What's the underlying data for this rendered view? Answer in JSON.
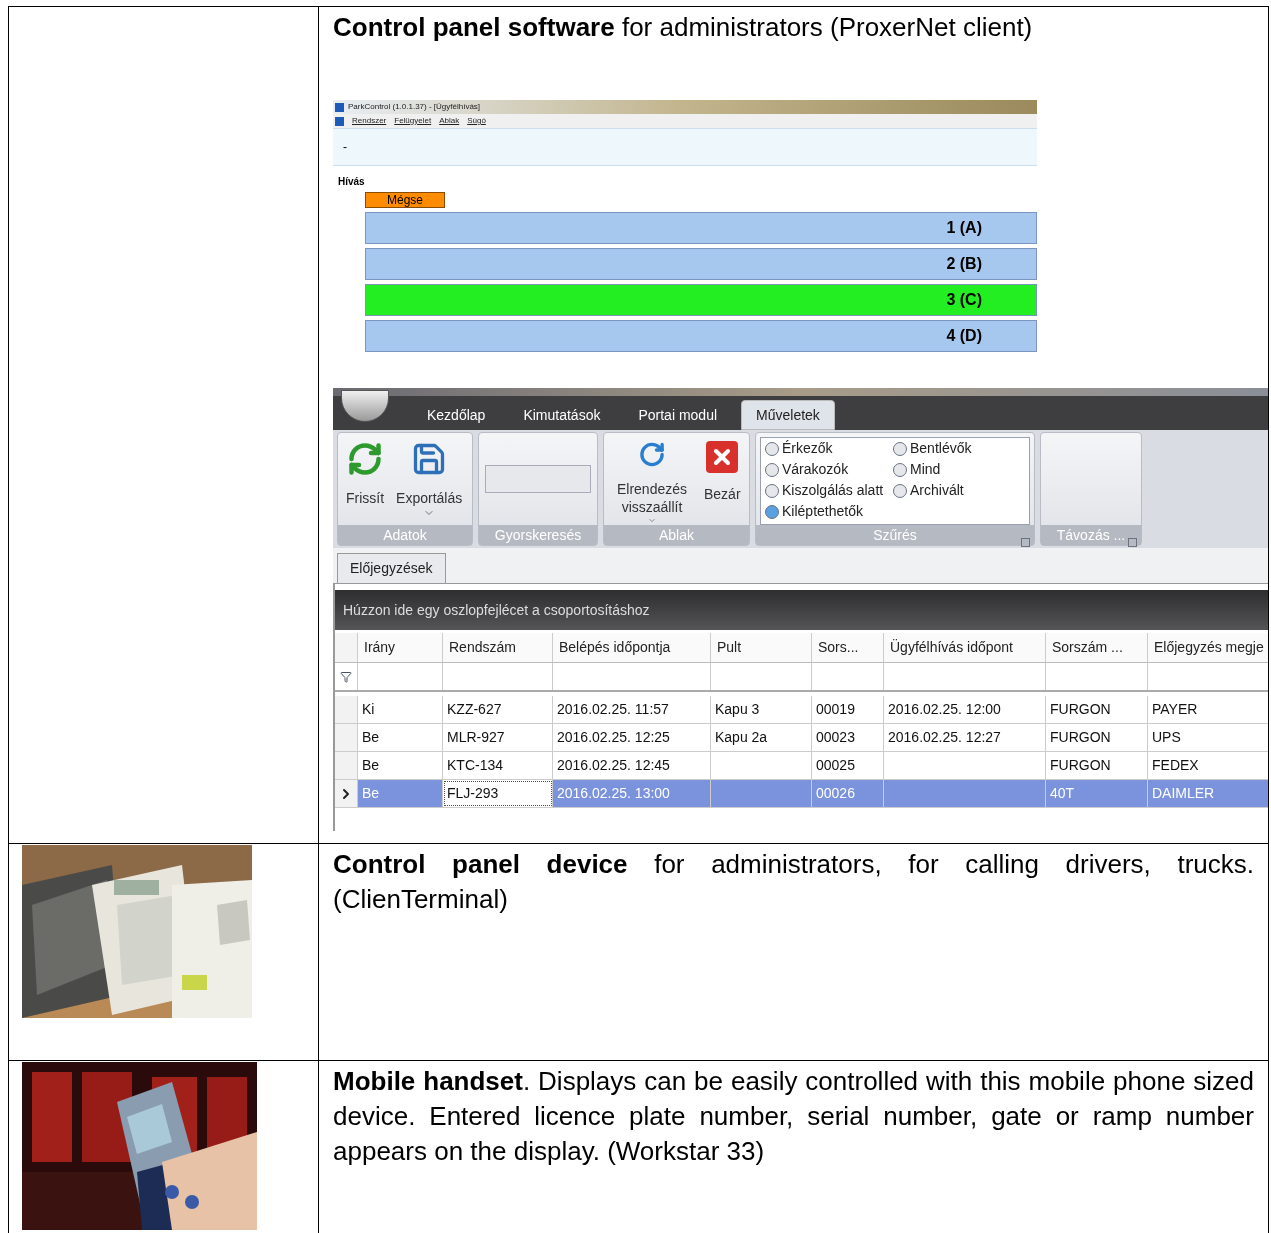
{
  "rows": [
    {
      "left": {
        "kind": "empty"
      },
      "description": "**Control panel software** for administrators (ProxerNet client)",
      "call_window": {
        "title": "ParkControl (1.0.1.37) - [Ügyfélhívás]",
        "menu": [
          "Rendszer",
          "Felügyelet",
          "Ablak",
          "Súgó"
        ],
        "status": "-",
        "group_label": "Hívás",
        "cancel_button": "Mégse",
        "calls": [
          {
            "label": "1 (A)",
            "selected": false
          },
          {
            "label": "2 (B)",
            "selected": false
          },
          {
            "label": "3 (C)",
            "selected": true
          },
          {
            "label": "4 (D)",
            "selected": false
          }
        ]
      },
      "admin_window": {
        "tabs": [
          {
            "label": "Kezdőlap",
            "selected": false
          },
          {
            "label": "Kimutatások",
            "selected": false
          },
          {
            "label": "Portai modul",
            "selected": false
          },
          {
            "label": "Műveletek",
            "selected": true
          }
        ],
        "groups": [
          {
            "kind": "buttons",
            "label": "Adatok",
            "buttons": [
              {
                "label": "Frissít",
                "dropdown": false
              },
              {
                "label": "Exportálás",
                "dropdown": true
              }
            ]
          },
          {
            "kind": "search",
            "label": "Gyorskeresés"
          },
          {
            "kind": "buttons",
            "label": "Ablak",
            "buttons": [
              {
                "label": "Elrendezés visszaállít",
                "dropdown": true
              },
              {
                "label": "Bezár",
                "dropdown": false
              }
            ]
          },
          {
            "kind": "filters",
            "label": "Szűrés",
            "options": [
              {
                "label": "Érkezők",
                "selected": false
              },
              {
                "label": "Bentlévők",
                "selected": false
              },
              {
                "label": "Várakozók",
                "selected": false
              },
              {
                "label": "Mind",
                "selected": false
              },
              {
                "label": "Kiszolgálás alatt",
                "selected": false
              },
              {
                "label": "Archivált",
                "selected": false
              },
              {
                "label": "Kiléptethetők",
                "selected": true
              }
            ]
          },
          {
            "kind": "empty",
            "label": "Távozás ..."
          }
        ],
        "document_tab": "Előjegyzések",
        "group_hint": "Húzzon ide egy oszlopfejlécet a csoportosításhoz",
        "columns": [
          "Irány",
          "Rendszám",
          "Belépés időpontja",
          "Pult",
          "Sors...",
          "Ügyfélhívás időpont",
          "Sorszám ...",
          "Előjegyzés megje"
        ],
        "table_rows": [
          {
            "selected": false,
            "cells": [
              {
                "text": "Ki",
                "focused": false
              },
              {
                "text": "KZZ-627",
                "focused": false
              },
              {
                "text": "2016.02.25. 11:57",
                "focused": false
              },
              {
                "text": "Kapu 3",
                "focused": false
              },
              {
                "text": "00019",
                "focused": false
              },
              {
                "text": "2016.02.25. 12:00",
                "focused": false
              },
              {
                "text": "FURGON",
                "focused": false
              },
              {
                "text": "PAYER",
                "focused": false
              }
            ]
          },
          {
            "selected": false,
            "cells": [
              {
                "text": "Be",
                "focused": false
              },
              {
                "text": "MLR-927",
                "focused": false
              },
              {
                "text": "2016.02.25. 12:25",
                "focused": false
              },
              {
                "text": "Kapu 2a",
                "focused": false
              },
              {
                "text": "00023",
                "focused": false
              },
              {
                "text": "2016.02.25. 12:27",
                "focused": false
              },
              {
                "text": "FURGON",
                "focused": false
              },
              {
                "text": "UPS",
                "focused": false
              }
            ]
          },
          {
            "selected": false,
            "cells": [
              {
                "text": "Be",
                "focused": false
              },
              {
                "text": "KTC-134",
                "focused": false
              },
              {
                "text": "2016.02.25. 12:45",
                "focused": false
              },
              {
                "focused": false
              },
              {
                "text": "00025",
                "focused": false
              },
              {
                "focused": false
              },
              {
                "text": "FURGON",
                "focused": false
              },
              {
                "text": "FEDEX",
                "focused": false
              }
            ]
          },
          {
            "selected": true,
            "cells": [
              {
                "text": "Be",
                "focused": false
              },
              {
                "text": "FLJ-293",
                "focused": true
              },
              {
                "text": "2016.02.25. 13:00",
                "focused": false
              },
              {
                "focused": false
              },
              {
                "text": "00026",
                "focused": false
              },
              {
                "focused": false
              },
              {
                "text": "40T",
                "focused": false
              },
              {
                "text": "DAIMLER",
                "focused": false
              }
            ]
          }
        ]
      }
    },
    {
      "description": "**Control panel device** for administrators, for calling drivers, trucks. (ClienTerminal)"
    },
    {
      "description": "**Mobile handset**. Displays can be easily controlled with this mobile phone sized device. Entered licence plate number, serial number, gate or ramp number appears on the display. (Workstar 33)"
    }
  ]
}
